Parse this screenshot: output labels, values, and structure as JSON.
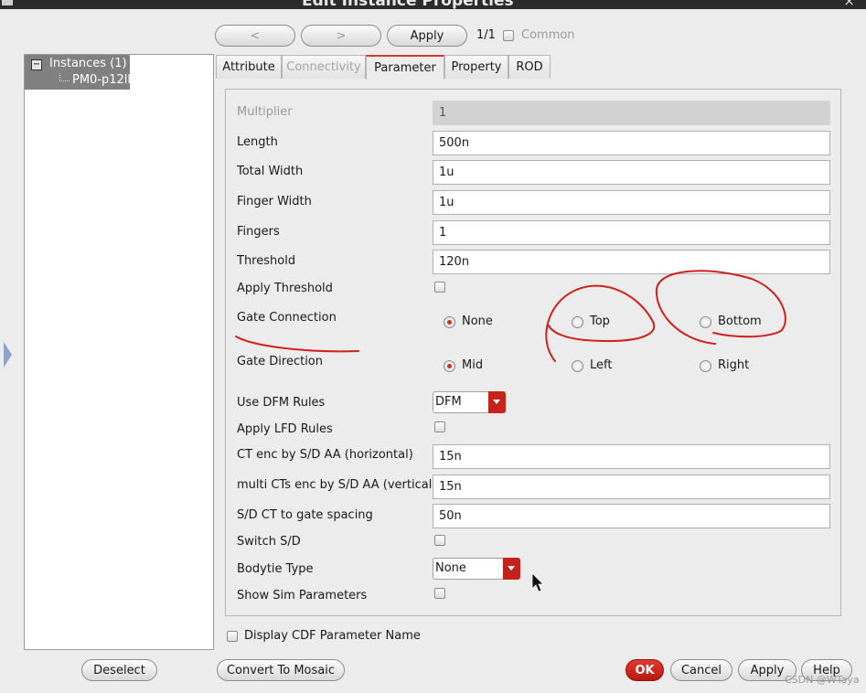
{
  "window": {
    "title": "Edit Instance Properties",
    "close_glyph": "×"
  },
  "toolbar": {
    "prev_label": "<",
    "next_label": ">",
    "apply_label": "Apply",
    "counter": "1/1",
    "common_label": "Common"
  },
  "tree": {
    "root_label": "Instances (1)",
    "child_label": "PM0-p12ll"
  },
  "tabs": [
    {
      "label": "Attribute",
      "state": "normal"
    },
    {
      "label": "Connectivity",
      "state": "disabled"
    },
    {
      "label": "Parameter",
      "state": "active"
    },
    {
      "label": "Property",
      "state": "normal"
    },
    {
      "label": "ROD",
      "state": "normal"
    }
  ],
  "params": {
    "multiplier": {
      "label": "Multiplier",
      "value": "1"
    },
    "length": {
      "label": "Length",
      "value": "500n"
    },
    "total_width": {
      "label": "Total Width",
      "value": "1u"
    },
    "finger_width": {
      "label": "Finger Width",
      "value": "1u"
    },
    "fingers": {
      "label": "Fingers",
      "value": "1"
    },
    "threshold": {
      "label": "Threshold",
      "value": "120n"
    },
    "apply_threshold": {
      "label": "Apply Threshold"
    },
    "gate_connection": {
      "label": "Gate Connection",
      "options": [
        "None",
        "Top",
        "Bottom"
      ],
      "selected": "None"
    },
    "gate_direction": {
      "label": "Gate Direction",
      "options": [
        "Mid",
        "Left",
        "Right"
      ],
      "selected": "Mid"
    },
    "use_dfm_rules": {
      "label": "Use DFM Rules",
      "value": "DFM"
    },
    "apply_lfd_rules": {
      "label": "Apply LFD Rules"
    },
    "ct_enc_h": {
      "label": "CT enc by S/D AA (horizontal)",
      "value": "15n"
    },
    "ct_enc_v": {
      "label": " multi CTs enc by S/D AA (vertical)",
      "value": "15n"
    },
    "sd_ct_spacing": {
      "label": "S/D CT to gate spacing",
      "value": "50n"
    },
    "switch_sd": {
      "label": "Switch S/D"
    },
    "bodytie_type": {
      "label": "Bodytie Type",
      "value": "None"
    },
    "show_sim": {
      "label": "Show Sim Parameters"
    }
  },
  "display_cdf_label": "Display CDF Parameter Name",
  "bottom": {
    "deselect": "Deselect",
    "convert": "Convert To Mosaic",
    "ok": "OK",
    "cancel": "Cancel",
    "apply": "Apply",
    "help": "Help"
  },
  "watermark": "CSDN @WTaya",
  "colors": {
    "accent_red": "#c4221a",
    "annotation_red": "#d0201a"
  }
}
